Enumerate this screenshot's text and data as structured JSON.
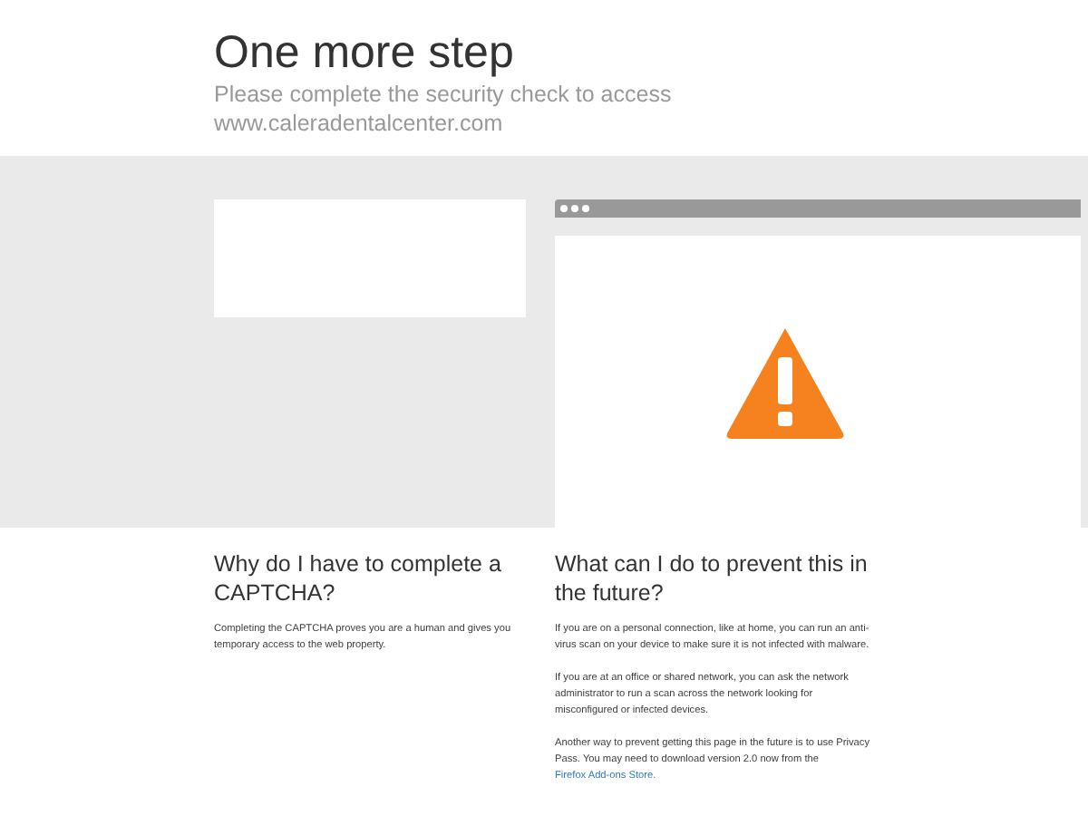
{
  "header": {
    "title": "One more step",
    "subtitle": "Please complete the security check to access",
    "domain": "www.caleradentalcenter.com"
  },
  "left_column": {
    "heading": "Why do I have to complete a CAPTCHA?",
    "paragraphs": [
      "Completing the CAPTCHA proves you are a human and gives you temporary access to the web property."
    ]
  },
  "right_column": {
    "heading": "What can I do to prevent this in the future?",
    "paragraphs": [
      {
        "text": "If you are on a personal connection, like at home, you can run an anti-virus scan on your device to make sure it is not infected with malware."
      },
      {
        "text": "If you are at an office or shared network, you can ask the network administrator to run a scan across the network looking for misconfigured or infected devices."
      },
      {
        "text": "Another way to prevent getting this page in the future is to use Privacy Pass. You may need to download version 2.0 now from the",
        "link": "Firefox Add-ons Store."
      }
    ]
  }
}
